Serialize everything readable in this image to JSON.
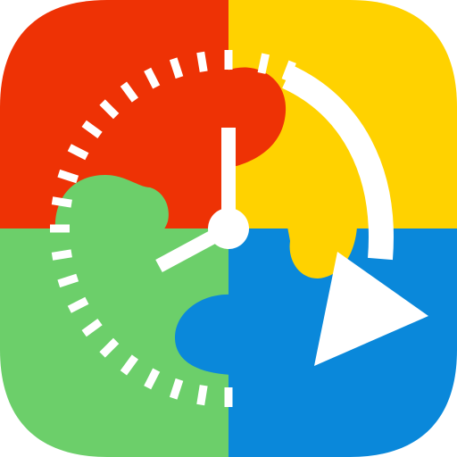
{
  "icon": {
    "name": "puzzle-clock-app-icon",
    "colors": {
      "red": "#EE3205",
      "yellow": "#FFD200",
      "green": "#6CCF6A",
      "blue": "#0A88DA",
      "clock_marks": "#ffffff",
      "background": "#ffffff"
    },
    "glyphs": [
      "puzzle-quadrant-red-icon",
      "puzzle-quadrant-yellow-icon",
      "puzzle-quadrant-green-icon",
      "puzzle-quadrant-blue-icon",
      "dashed-clock-face-icon",
      "clock-hands-icon",
      "clockwise-arrow-icon"
    ]
  }
}
